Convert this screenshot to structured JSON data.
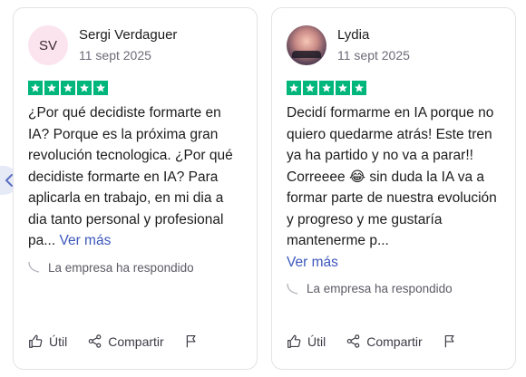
{
  "colors": {
    "star_green": "#00b67a",
    "link_blue": "#3c57bc",
    "avatar_pink": "#fbe4ee"
  },
  "nav": {
    "prev_icon": "chevron-left-icon"
  },
  "reviews": [
    {
      "avatar_initials": "SV",
      "name": "Sergi Verdaguer",
      "date": "11 sept 2025",
      "rating": 5,
      "text": "¿Por qué decidiste formarte en IA? Porque es la próxima gran revolución tecnologica. ¿Por qué decidiste formarte en IA? Para aplicarla en trabajo, en mi dia a dia tanto personal y profesional pa...",
      "more_label": "Ver más",
      "replied_label": "La empresa ha respondido",
      "useful_label": "Útil",
      "share_label": "Compartir"
    },
    {
      "avatar_initials": "",
      "name": "Lydia",
      "date": "11 sept 2025",
      "rating": 5,
      "text": "Decidí formarme en IA porque no quiero quedarme atrás! Este tren ya ha partido y no va a parar!! Correeee 😂 sin duda la IA va a formar parte de nuestra evolución y progreso y me gustaría mantenerme p...",
      "more_label": "Ver más",
      "replied_label": "La empresa ha respondido",
      "useful_label": "Útil",
      "share_label": "Compartir"
    }
  ]
}
